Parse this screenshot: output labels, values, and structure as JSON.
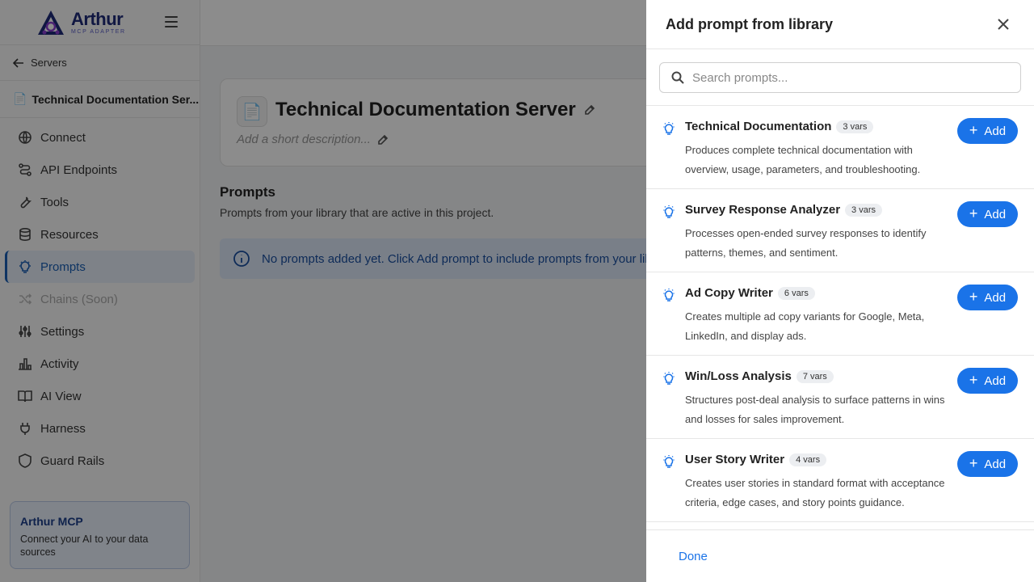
{
  "brand": {
    "name": "Arthur",
    "sub": "MCP ADAPTER"
  },
  "sidebar": {
    "back_label": "Servers",
    "server_name": "Technical Documentation Ser...",
    "items": [
      {
        "label": "Connect",
        "icon": "globe-icon"
      },
      {
        "label": "API Endpoints",
        "icon": "route-icon"
      },
      {
        "label": "Tools",
        "icon": "wrench-icon"
      },
      {
        "label": "Resources",
        "icon": "database-icon"
      },
      {
        "label": "Prompts",
        "icon": "bulb-icon",
        "active": true
      },
      {
        "label": "Chains (Soon)",
        "icon": "shuffle-icon",
        "disabled": true
      },
      {
        "label": "Settings",
        "icon": "sliders-icon"
      },
      {
        "label": "Activity",
        "icon": "bar-chart-icon"
      },
      {
        "label": "AI View",
        "icon": "book-icon"
      },
      {
        "label": "Harness",
        "icon": "plug-icon"
      },
      {
        "label": "Guard Rails",
        "icon": "shield-icon"
      }
    ],
    "promo": {
      "title": "Arthur MCP",
      "text": "Connect your AI to your data sources"
    }
  },
  "main": {
    "server_title": "Technical Documentation Server",
    "description_placeholder": "Add a short description...",
    "section_title": "Prompts",
    "section_subtitle": "Prompts from your library that are active in this project.",
    "alert_text": "No prompts added yet. Click Add prompt to include prompts from your library"
  },
  "drawer": {
    "title": "Add prompt from library",
    "search_placeholder": "Search prompts...",
    "add_label": "Add",
    "done_label": "Done",
    "prompts": [
      {
        "title": "Technical Documentation",
        "vars": "3 vars",
        "desc": "Produces complete technical documentation with overview, usage, parameters, and troubleshooting."
      },
      {
        "title": "Survey Response Analyzer",
        "vars": "3 vars",
        "desc": "Processes open-ended survey responses to identify patterns, themes, and sentiment."
      },
      {
        "title": "Ad Copy Writer",
        "vars": "6 vars",
        "desc": "Creates multiple ad copy variants for Google, Meta, LinkedIn, and display ads."
      },
      {
        "title": "Win/Loss Analysis",
        "vars": "7 vars",
        "desc": "Structures post-deal analysis to surface patterns in wins and losses for sales improvement."
      },
      {
        "title": "User Story Writer",
        "vars": "4 vars",
        "desc": "Creates user stories in standard format with acceptance criteria, edge cases, and story points guidance."
      }
    ]
  },
  "colors": {
    "accent": "#1a73e8",
    "brand": "#1e2a78",
    "overlay": "rgba(0,0,0,0.45)"
  }
}
